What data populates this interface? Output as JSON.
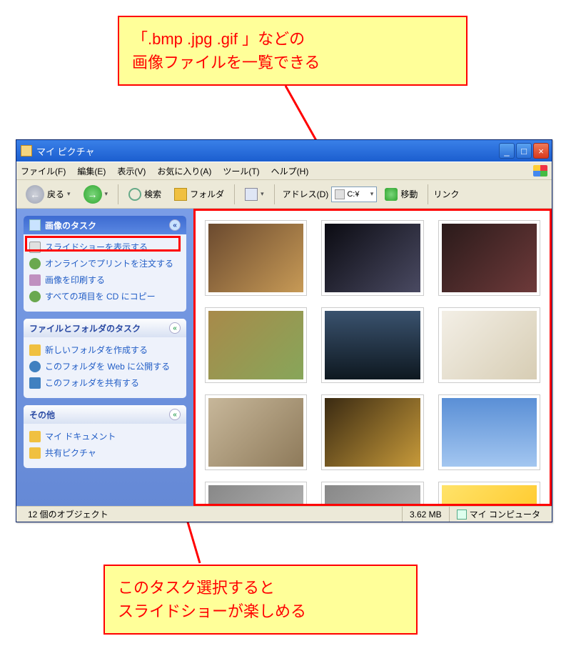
{
  "callouts": {
    "top": "「.bmp .jpg .gif 」などの\n画像ファイルを一覧できる",
    "bottom": "このタスク選択すると\nスライドショーが楽しめる"
  },
  "window": {
    "title": "マイ ピクチャ",
    "buttons": {
      "min": "_",
      "max": "□",
      "close": "×"
    }
  },
  "menu": {
    "file": "ファイル(F)",
    "edit": "編集(E)",
    "view": "表示(V)",
    "favorites": "お気に入り(A)",
    "tools": "ツール(T)",
    "help": "ヘルプ(H)"
  },
  "toolbar": {
    "back": "戻る",
    "search": "検索",
    "folders": "フォルダ",
    "address_label": "アドレス(D)",
    "address_value": "C:¥",
    "go": "移動",
    "links": "リンク"
  },
  "sidebar": {
    "panel1": {
      "title": "画像のタスク",
      "items": [
        "スライドショーを表示する",
        "オンラインでプリントを注文する",
        "画像を印刷する",
        "すべての項目を CD にコピー"
      ]
    },
    "panel2": {
      "title": "ファイルとフォルダのタスク",
      "items": [
        "新しいフォルダを作成する",
        "このフォルダを Web に公開する",
        "このフォルダを共有する"
      ]
    },
    "panel3": {
      "title": "その他",
      "items": [
        "マイ ドキュメント",
        "共有ピクチャ"
      ]
    }
  },
  "thumbs": [
    {
      "bg": "linear-gradient(135deg,#6b4a2f,#c79a56)"
    },
    {
      "bg": "linear-gradient(135deg,#0b0b12,#4a4a62)"
    },
    {
      "bg": "linear-gradient(135deg,#2a1a1a,#6e3a3a)"
    },
    {
      "bg": "linear-gradient(135deg,#a88a4a,#87a65a)"
    },
    {
      "bg": "linear-gradient(180deg,#3a526e,#0e1820)"
    },
    {
      "bg": "linear-gradient(135deg,#f3efe6,#d7cdb4)"
    },
    {
      "bg": "linear-gradient(135deg,#c7b79a,#8e7a5a)"
    },
    {
      "bg": "linear-gradient(135deg,#3a2a12,#c79a3a)"
    },
    {
      "bg": "linear-gradient(180deg,#5a8fd6,#a3c6f0)"
    },
    {
      "bg": "linear-gradient(135deg,#888,#bbb)"
    },
    {
      "bg": "linear-gradient(135deg,#888,#bbb)"
    },
    {
      "bg": "linear-gradient(135deg,#ffe36a,#ffc21a)"
    }
  ],
  "status": {
    "count": "12 個のオブジェクト",
    "size": "3.62 MB",
    "location": "マイ コンピュータ"
  },
  "icon_colors": {
    "task1": "#e0e0e0",
    "task2": "#6aa84f",
    "task3": "#c090c0",
    "task4": "#6aa84f",
    "ff1": "#f0c040",
    "ff2": "#4080c0",
    "ff3": "#4080c0",
    "oth1": "#f0c040",
    "oth2": "#f0c040"
  }
}
